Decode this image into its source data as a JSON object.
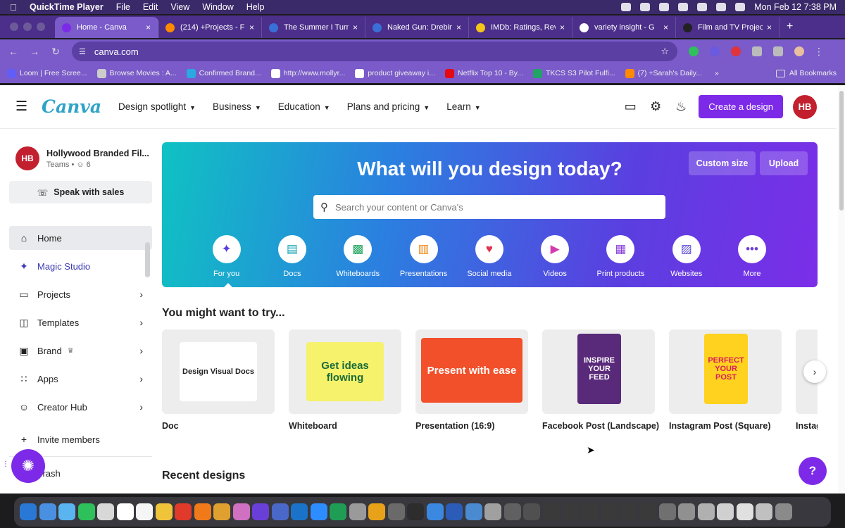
{
  "menubar": {
    "app": "QuickTime Player",
    "items": [
      "File",
      "Edit",
      "View",
      "Window",
      "Help"
    ],
    "clock": "Mon Feb 12  7:38 PM"
  },
  "tabs": [
    {
      "title": "Home - Canva",
      "color": "#7d2ae8",
      "active": true
    },
    {
      "title": "(214) +Projects - F",
      "color": "#ff8a00"
    },
    {
      "title": "The Summer I Turn",
      "color": "#3a6fd8"
    },
    {
      "title": "Naked Gun: Drebin",
      "color": "#3a6fd8"
    },
    {
      "title": "IMDb: Ratings, Rev",
      "color": "#f5c518"
    },
    {
      "title": "variety insight - G",
      "color": "#ffffff"
    },
    {
      "title": "Film and TV Projec",
      "color": "#222222"
    }
  ],
  "url": "canva.com",
  "bookmarks": [
    {
      "label": "Loom | Free Scree...",
      "color": "#625df5"
    },
    {
      "label": "Browse Movies : A...",
      "color": "#cccccc"
    },
    {
      "label": "Confirmed Brand...",
      "color": "#2aa8e0"
    },
    {
      "label": "http://www.mollyr...",
      "color": "#ffffff"
    },
    {
      "label": "product giveaway i...",
      "color": "#ffffff"
    },
    {
      "label": "Netflix Top 10 - By...",
      "color": "#e50914"
    },
    {
      "label": "TKCS S3 Pilot Fulfi...",
      "color": "#21a366"
    },
    {
      "label": "(7) +Sarah's Daily...",
      "color": "#ff8a00"
    }
  ],
  "bookmarks_all": "All Bookmarks",
  "nav": {
    "logo": "Canva",
    "items": [
      "Design spotlight",
      "Business",
      "Education",
      "Plans and pricing",
      "Learn"
    ],
    "create": "Create a design",
    "avatar": "HB"
  },
  "sidebar": {
    "team_avatar": "HB",
    "team_name": "Hollywood Branded Fil...",
    "team_sub": "Teams • ☺ 6",
    "speak": "Speak with sales",
    "items": [
      {
        "label": "Home",
        "icon": "⌂",
        "arrow": ""
      },
      {
        "label": "Magic Studio",
        "icon": "✦",
        "arrow": ""
      },
      {
        "label": "Projects",
        "icon": "▭",
        "arrow": "›"
      },
      {
        "label": "Templates",
        "icon": "◫",
        "arrow": "›"
      },
      {
        "label": "Brand",
        "icon": "▣",
        "arrow": "›",
        "badge": "♛"
      },
      {
        "label": "Apps",
        "icon": "∷",
        "arrow": "›"
      },
      {
        "label": "Creator Hub",
        "icon": "☺",
        "arrow": "›"
      }
    ],
    "invite": "Invite members",
    "trash": "Trash"
  },
  "hero": {
    "title": "What will you design today?",
    "custom": "Custom size",
    "upload": "Upload",
    "search_placeholder": "Search your content or Canva's",
    "cats": [
      {
        "label": "For you",
        "icon": "✦",
        "color": "#5a3fe0"
      },
      {
        "label": "Docs",
        "icon": "▤",
        "color": "#13a3b5"
      },
      {
        "label": "Whiteboards",
        "icon": "▩",
        "color": "#1ba35a"
      },
      {
        "label": "Presentations",
        "icon": "▥",
        "color": "#f08a1c"
      },
      {
        "label": "Social media",
        "icon": "♥",
        "color": "#e0334f"
      },
      {
        "label": "Videos",
        "icon": "▶",
        "color": "#d43ab0"
      },
      {
        "label": "Print products",
        "icon": "▦",
        "color": "#8a3fd8"
      },
      {
        "label": "Websites",
        "icon": "▨",
        "color": "#5a4ae0"
      },
      {
        "label": "More",
        "icon": "•••",
        "color": "#6a3fd8"
      }
    ]
  },
  "try": {
    "title": "You might want to try...",
    "cards": [
      {
        "label": "Doc",
        "text": "Design Visual Docs",
        "bg": "#ffffff",
        "fg": "#222222"
      },
      {
        "label": "Whiteboard",
        "text": "Get ideas flowing",
        "bg": "#f6f26b",
        "fg": "#1a6b3a"
      },
      {
        "label": "Presentation (16:9)",
        "text": "Present with ease",
        "bg": "#f2502a",
        "fg": "#ffffff"
      },
      {
        "label": "Facebook Post (Landscape)",
        "text": "INSPIRE YOUR FEED",
        "bg": "#5a2a7a",
        "fg": "#ffffff"
      },
      {
        "label": "Instagram Post (Square)",
        "text": "PERFECT YOUR POST",
        "bg": "#ffd21f",
        "fg": "#d81e5b"
      },
      {
        "label": "Instag",
        "text": "",
        "bg": "#ededee",
        "fg": "#222222"
      }
    ]
  },
  "recent": "Recent designs",
  "help": "?",
  "dock": [
    "#2a78d6",
    "#4a90e2",
    "#5ab4f0",
    "#2ec05a",
    "#d8d8d8",
    "#ffffff",
    "#f5f5f5",
    "#f0c43a",
    "#e03a2a",
    "#f07a1a",
    "#e0a030",
    "#d070c0",
    "#6a3fd8",
    "#4a68c8",
    "#1a73c8",
    "#2d8cff",
    "#1f9d55",
    "#9a9a9a",
    "#e8a21a",
    "#6a6a6a",
    "#2d2d2d",
    "#3a88e0",
    "#2b5db8",
    "#4a8ad0",
    "#a0a0a0",
    "#606060",
    "#505050",
    "#3a3a3a",
    "#3a3a3a",
    "#3a3a3a",
    "#3a3a3a",
    "#3a3a3a",
    "#3a3a3a",
    "#707070",
    "#909090",
    "#b0b0b0",
    "#d0d0d0",
    "#e0e0e0",
    "#c0c0c0",
    "#8a8a8a"
  ]
}
